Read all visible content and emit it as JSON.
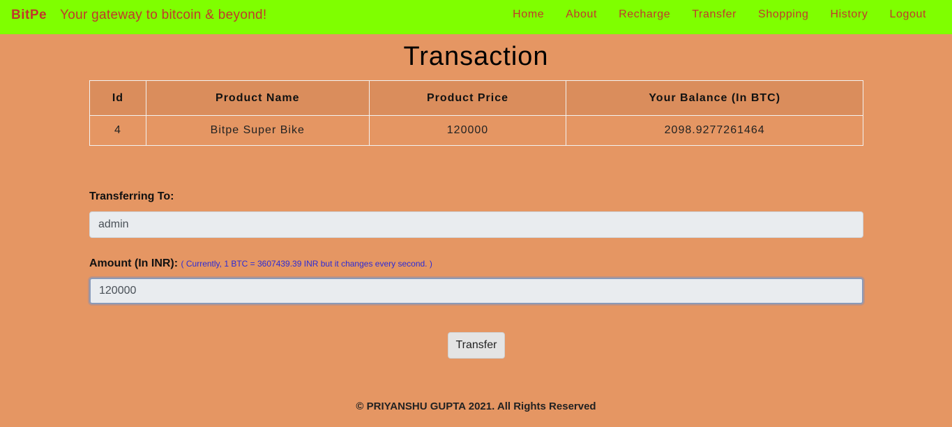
{
  "navbar": {
    "brand": "BitPe",
    "tagline": "Your gateway to bitcoin & beyond!",
    "links": [
      "Home",
      "About",
      "Recharge",
      "Transfer",
      "Shopping",
      "History",
      "Logout"
    ]
  },
  "page": {
    "title": "Transaction"
  },
  "table": {
    "headers": [
      "Id",
      "Product Name",
      "Product Price",
      "Your Balance (In BTC)"
    ],
    "rows": [
      [
        "4",
        "Bitpe Super Bike",
        "120000",
        "2098.9277261464"
      ]
    ]
  },
  "form": {
    "transfer_to_label": "Transferring To:",
    "transfer_to_value": "admin",
    "amount_label": "Amount (In INR):",
    "amount_note": "( Currently, 1 BTC = 3607439.39 INR but it changes every second. )",
    "amount_value": "120000",
    "submit_label": "Transfer"
  },
  "footer": {
    "text": "© PRIYANSHU GUPTA 2021. All Rights Reserved"
  },
  "colors": {
    "navbar_bg": "#7fff00",
    "page_bg": "#e59663",
    "brand_text": "#c0392b",
    "note_text": "#2b2bd6"
  }
}
